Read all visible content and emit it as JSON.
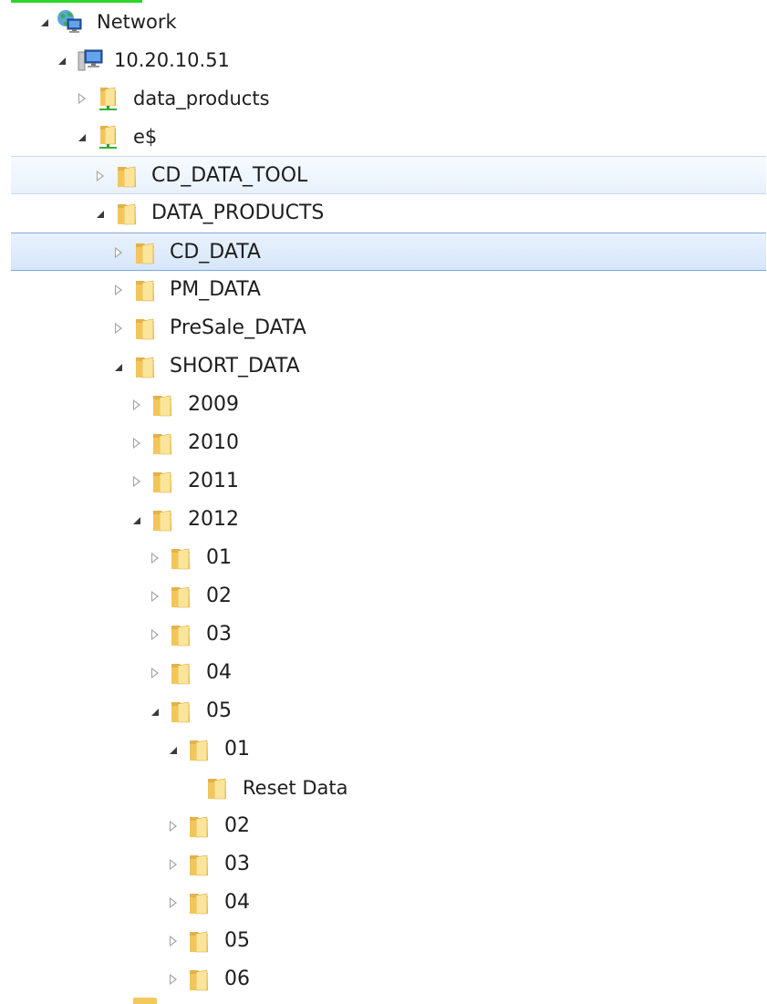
{
  "tree": {
    "network": "Network",
    "host": "10.20.10.51",
    "share_data_products": "data_products",
    "share_e": "e$",
    "cd_data_tool": "CD_DATA_TOOL",
    "data_products": "DATA_PRODUCTS",
    "cd_data": "CD_DATA",
    "pm_data": "PM_DATA",
    "presale_data": "PreSale_DATA",
    "short_data": "SHORT_DATA",
    "y2009": "2009",
    "y2010": "2010",
    "y2011": "2011",
    "y2012": "2012",
    "m01": "01",
    "m02": "02",
    "m03": "03",
    "m04": "04",
    "m05": "05",
    "d01": "01",
    "reset_data": "Reset Data",
    "d02": "02",
    "d03": "03",
    "d04": "04",
    "d05": "05",
    "d06": "06"
  },
  "colors": {
    "folder": "#f1c95c",
    "selection_border": "#7fa9dd",
    "hover_border": "#c5daf5"
  },
  "icons": {
    "network": "network-globe-icon",
    "computer": "computer-icon",
    "share": "network-share-icon",
    "folder": "folder-icon"
  }
}
